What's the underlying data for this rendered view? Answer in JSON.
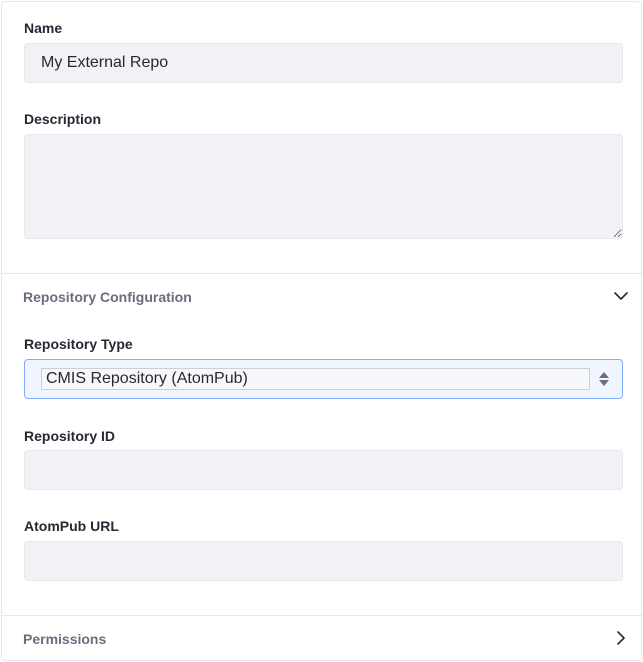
{
  "form": {
    "name": {
      "label": "Name",
      "value": "My External Repo"
    },
    "description": {
      "label": "Description",
      "value": ""
    },
    "repository_configuration": {
      "title": "Repository Configuration",
      "expanded": true,
      "repository_type": {
        "label": "Repository Type",
        "selected": "CMIS Repository (AtomPub)"
      },
      "repository_id": {
        "label": "Repository ID",
        "value": ""
      },
      "atompub_url": {
        "label": "AtomPub URL",
        "value": ""
      }
    },
    "permissions": {
      "title": "Permissions",
      "expanded": false
    }
  },
  "icons": {
    "config_toggle": "chevron-down-icon",
    "permissions_toggle": "chevron-right-icon",
    "select_arrows": "caret-double-icon",
    "resize_handle": "resize-grip-icon"
  },
  "colors": {
    "input_bg": "#f1f2f5",
    "select_focus_border": "#80acff",
    "section_title": "#6b6c7e"
  }
}
